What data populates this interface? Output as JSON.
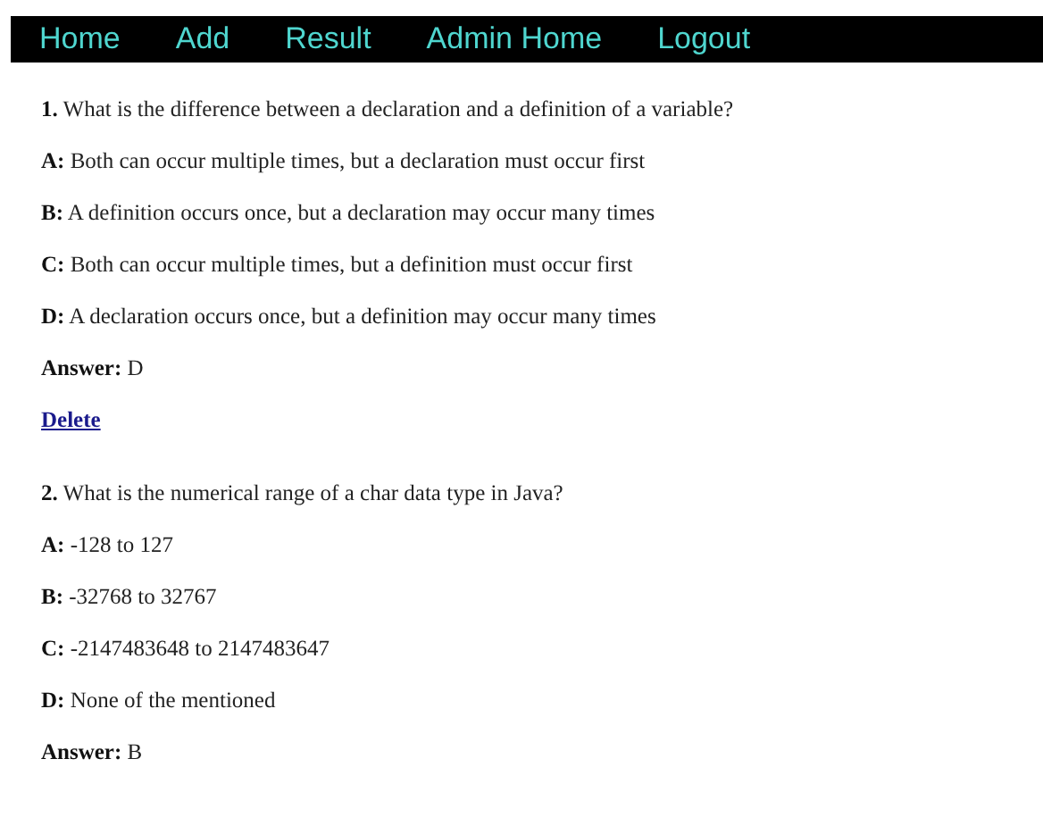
{
  "nav": [
    {
      "label": "Home"
    },
    {
      "label": "Add"
    },
    {
      "label": "Result"
    },
    {
      "label": "Admin Home"
    },
    {
      "label": "Logout"
    }
  ],
  "questions": [
    {
      "number": "1.",
      "text": "What is the difference between a declaration and a definition of a variable?",
      "options": [
        {
          "letter": "A:",
          "text": "Both can occur multiple times, but a declaration must occur first"
        },
        {
          "letter": "B:",
          "text": "A definition occurs once, but a declaration may occur many times"
        },
        {
          "letter": "C:",
          "text": "Both can occur multiple times, but a definition must occur first"
        },
        {
          "letter": "D:",
          "text": "A declaration occurs once, but a definition may occur many times"
        }
      ],
      "answer_label": "Answer:",
      "answer": "D",
      "delete_link": "Delete"
    },
    {
      "number": "2.",
      "text": "What is the numerical range of a char data type in Java?",
      "options": [
        {
          "letter": "A:",
          "text": "-128 to 127"
        },
        {
          "letter": "B:",
          "text": "-32768 to 32767"
        },
        {
          "letter": "C:",
          "text": "-2147483648 to 2147483647"
        },
        {
          "letter": "D:",
          "text": "None of the mentioned"
        }
      ],
      "answer_label": "Answer:",
      "answer": "B"
    }
  ]
}
